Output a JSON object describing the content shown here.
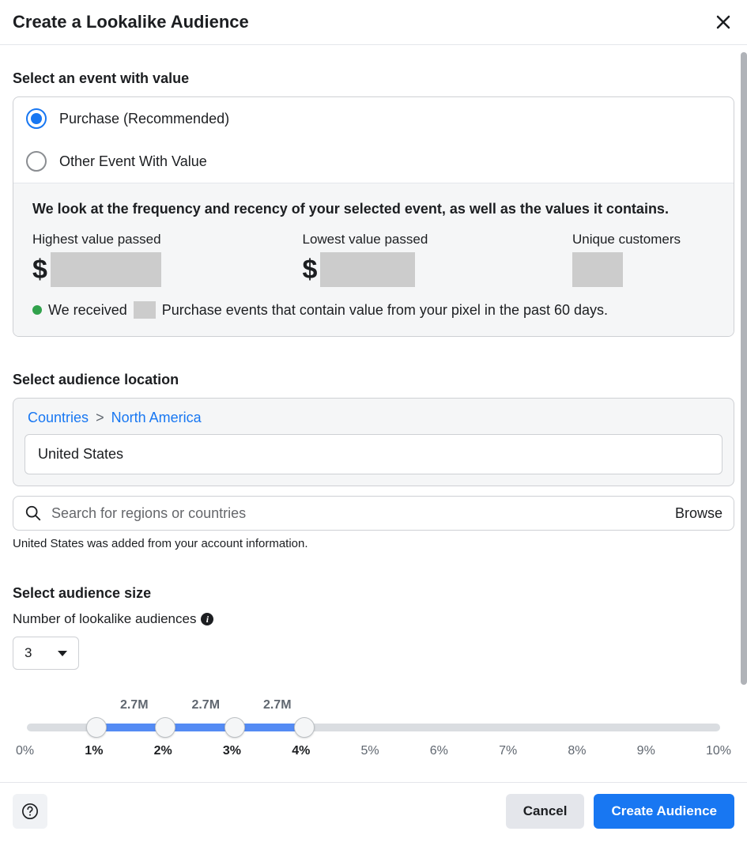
{
  "header": {
    "title": "Create a Lookalike Audience"
  },
  "event_section": {
    "title": "Select an event with value",
    "option_purchase": "Purchase (Recommended)",
    "option_other": "Other Event With Value",
    "info_heading": "We look at the frequency and recency of your selected event, as well as the values it contains.",
    "highest_label": "Highest value passed",
    "lowest_label": "Lowest value passed",
    "unique_label": "Unique customers",
    "dollar_symbol": "$",
    "events_text_pre": "We received",
    "events_text_post": "Purchase events that contain value from your pixel in the past 60 days."
  },
  "location_section": {
    "title": "Select audience location",
    "breadcrumb_countries": "Countries",
    "breadcrumb_sep": ">",
    "breadcrumb_region": "North America",
    "selected_location": "United States",
    "search_placeholder": "Search for regions or countries",
    "browse_label": "Browse",
    "helper_text": "United States was added from your account information."
  },
  "size_section": {
    "title": "Select audience size",
    "number_label": "Number of lookalike audiences",
    "select_value": "3",
    "segment_size_1": "2.7M",
    "segment_size_2": "2.7M",
    "segment_size_3": "2.7M",
    "ticks": [
      "0%",
      "1%",
      "2%",
      "3%",
      "4%",
      "5%",
      "6%",
      "7%",
      "8%",
      "9%",
      "10%"
    ]
  },
  "footer": {
    "cancel_label": "Cancel",
    "create_label": "Create Audience"
  }
}
